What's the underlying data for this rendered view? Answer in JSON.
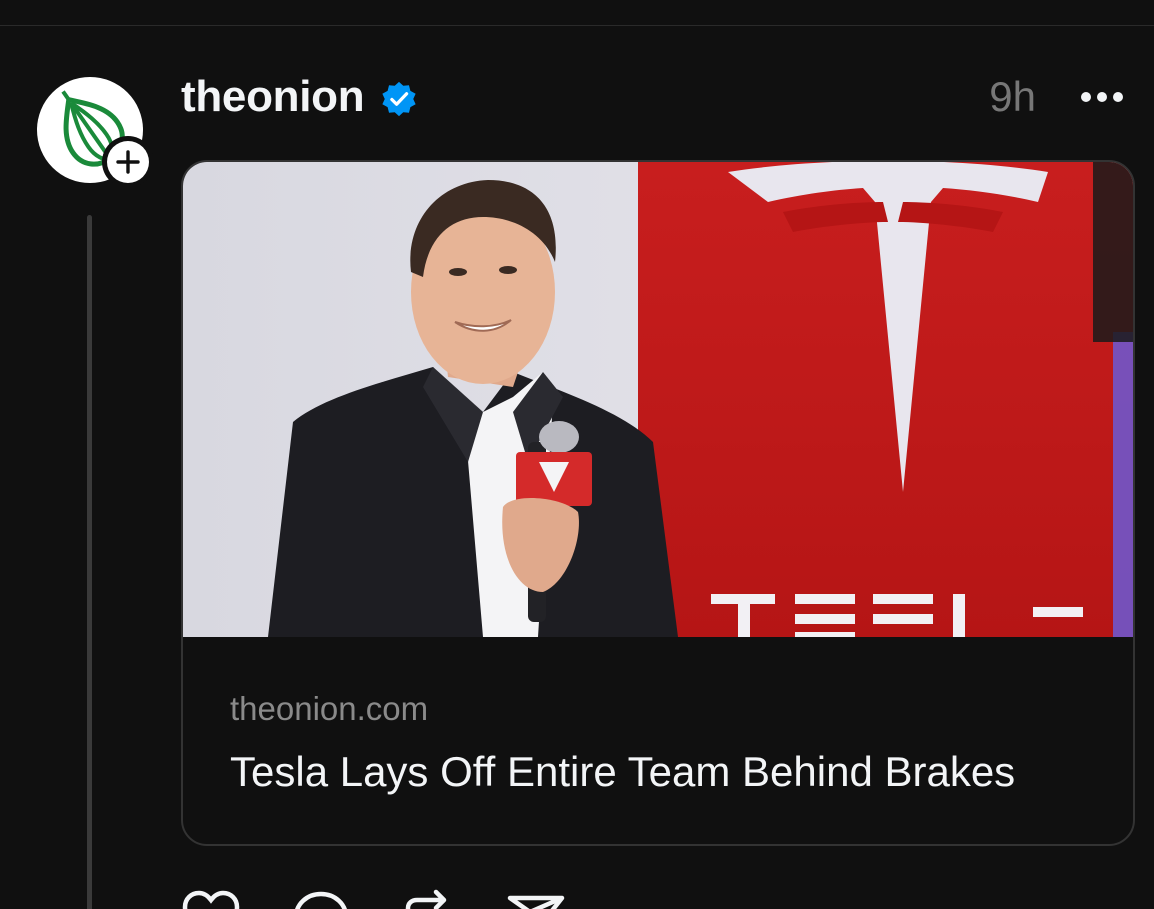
{
  "post": {
    "username": "theonion",
    "verified": true,
    "timestamp": "9h",
    "more_icon": "ellipsis-icon"
  },
  "link_card": {
    "domain": "theonion.com",
    "title": "Tesla Lays Off Entire Team Behind Brakes",
    "image_brand_text": "TESLA"
  },
  "actions": [
    {
      "name": "like",
      "icon": "heart-icon"
    },
    {
      "name": "reply",
      "icon": "comment-icon"
    },
    {
      "name": "repost",
      "icon": "repost-icon"
    },
    {
      "name": "share",
      "icon": "send-icon"
    }
  ],
  "colors": {
    "background": "#101010",
    "text_primary": "#f3f5f7",
    "text_secondary": "#777777",
    "verified_blue": "#0095f6",
    "onion_green": "#1a8a3a",
    "tesla_red": "#cc1f1f"
  }
}
